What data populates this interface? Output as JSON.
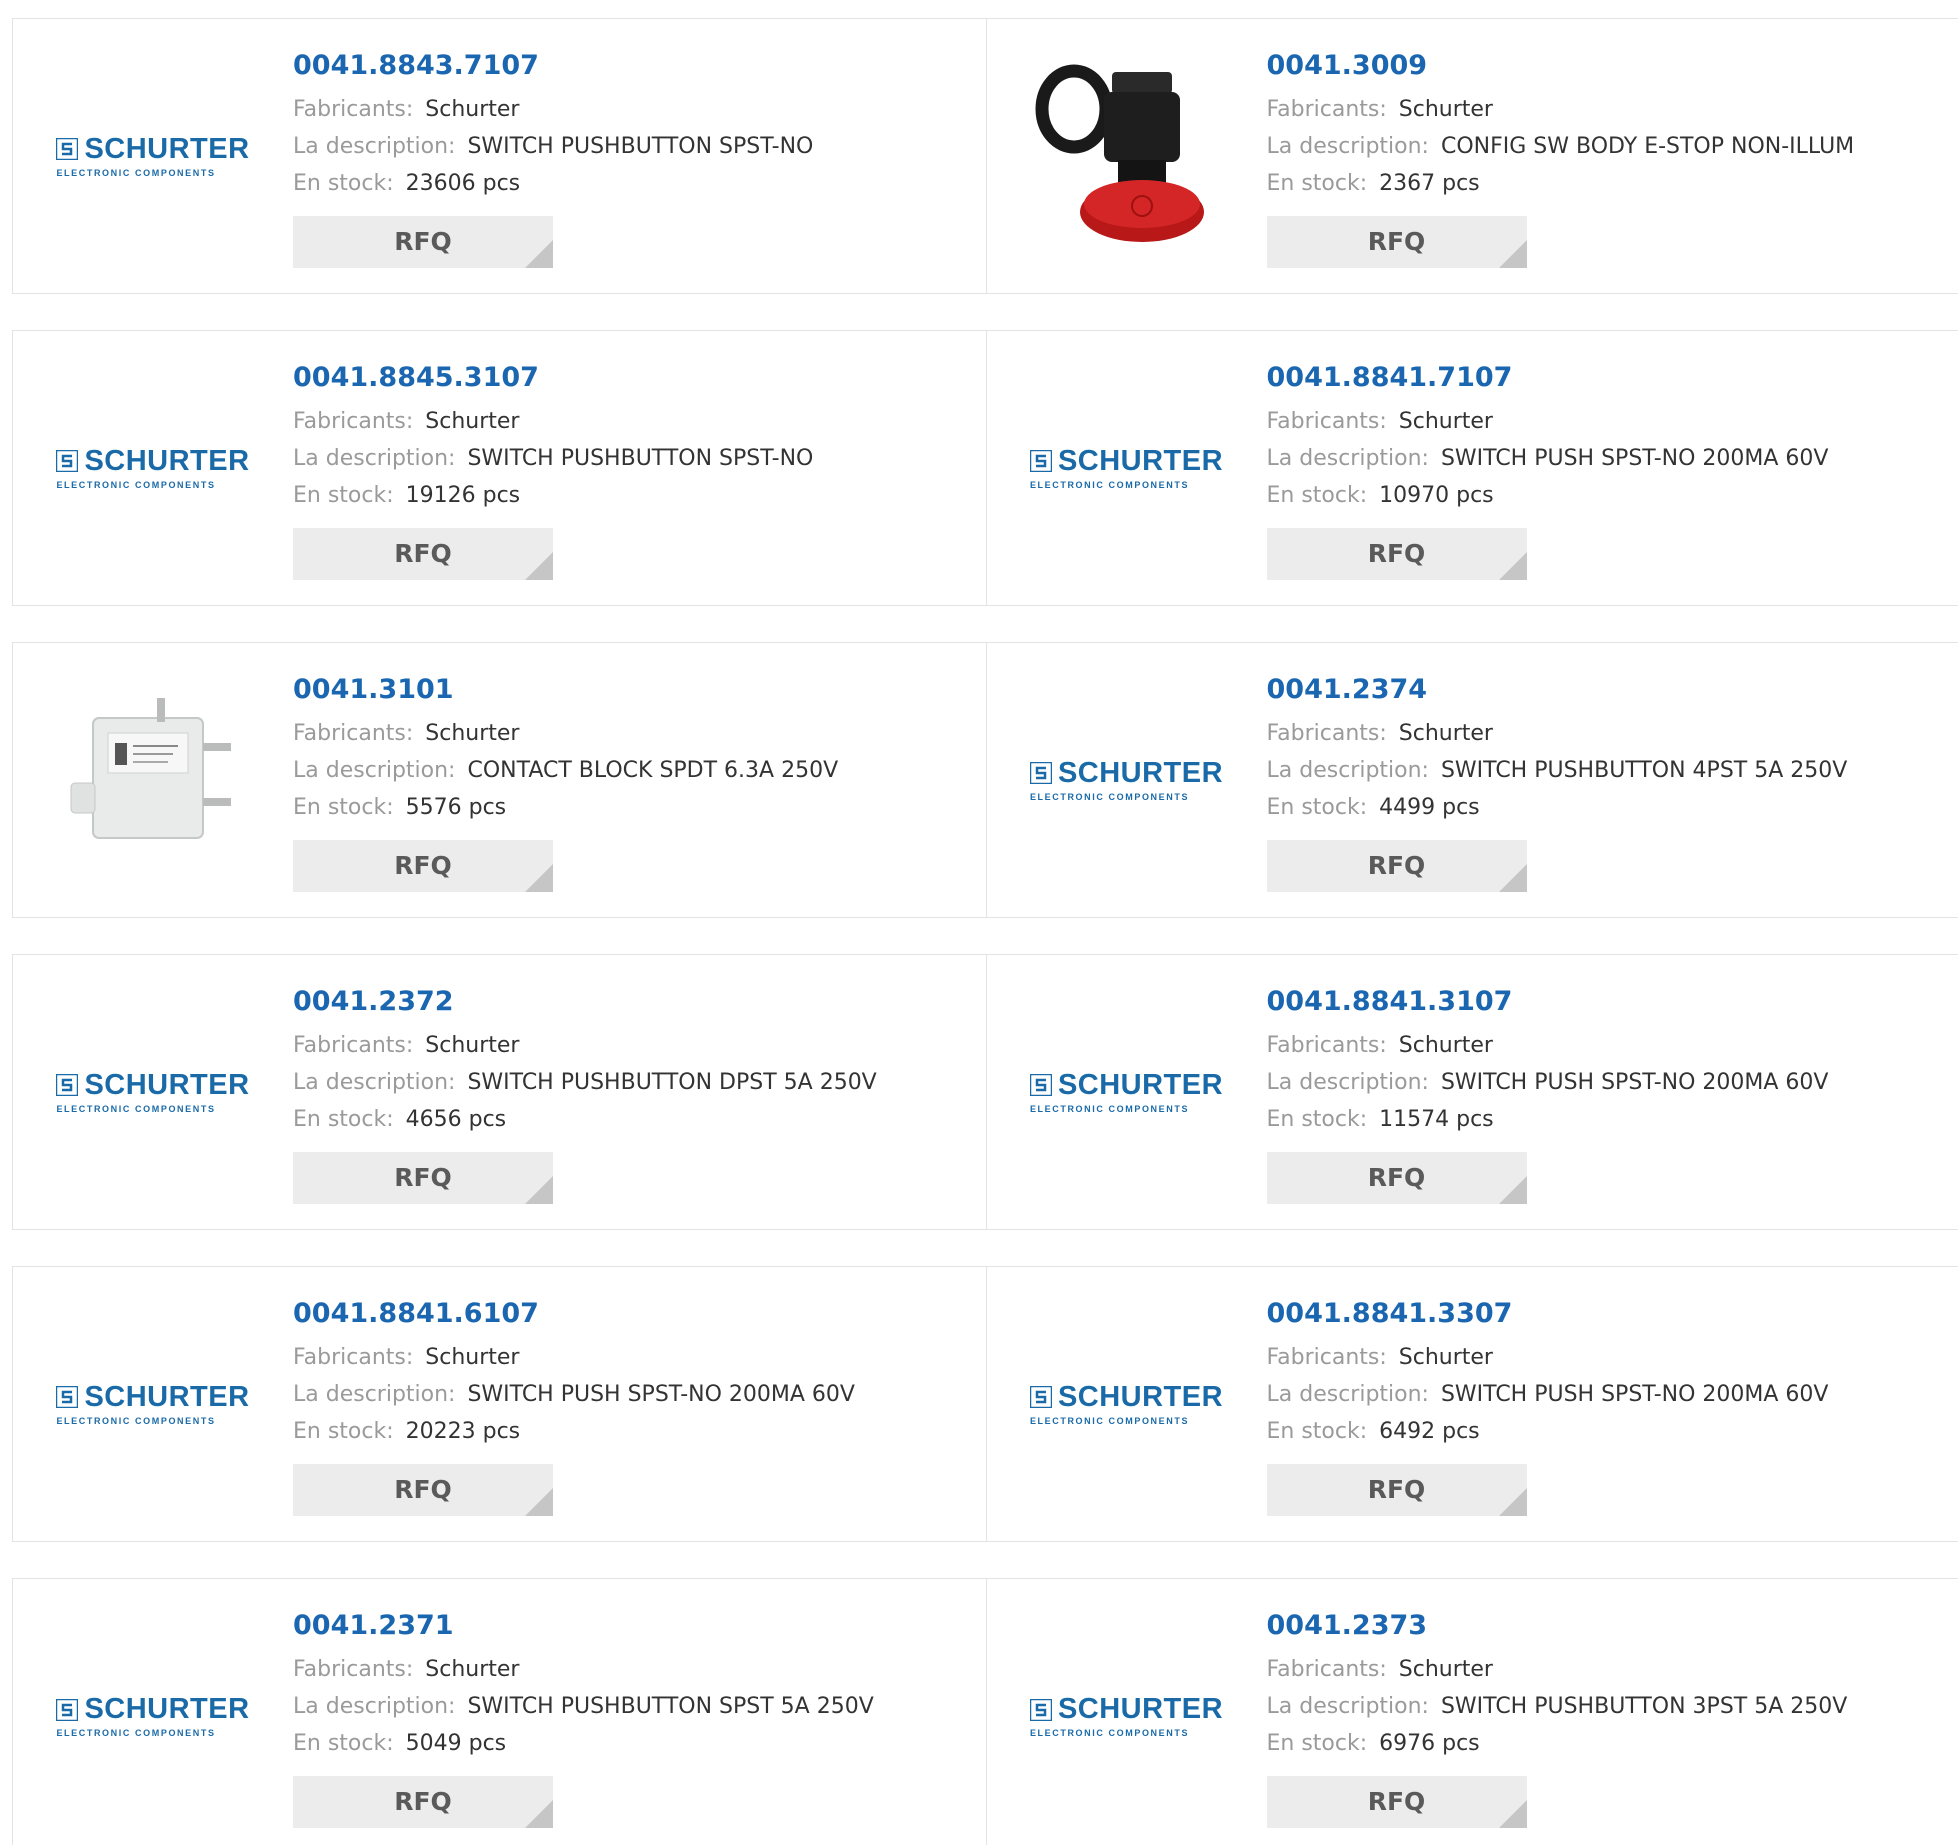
{
  "labels": {
    "manufacturer": "Fabricants:",
    "description": "La description:",
    "stock": "En stock:",
    "rfq": "RFQ"
  },
  "logo": {
    "wordmark": "SCHURTER",
    "tagline": "ELECTRONIC COMPONENTS",
    "color": "#1a6aa8"
  },
  "colors": {
    "part_link": "#1a66b0",
    "label": "#9a9a9a",
    "value": "#333333",
    "rfq_bg": "#ececec"
  },
  "products": [
    {
      "part": "0041.8843.7107",
      "manufacturer": "Schurter",
      "description": "SWITCH PUSHBUTTON SPST-NO",
      "stock": "23606 pcs",
      "image": "schurter-logo"
    },
    {
      "part": "0041.3009",
      "manufacturer": "Schurter",
      "description": "CONFIG SW BODY E-STOP NON-ILLUM",
      "stock": "2367 pcs",
      "image": "estop-switch-photo"
    },
    {
      "part": "0041.8845.3107",
      "manufacturer": "Schurter",
      "description": "SWITCH PUSHBUTTON SPST-NO",
      "stock": "19126 pcs",
      "image": "schurter-logo"
    },
    {
      "part": "0041.8841.7107",
      "manufacturer": "Schurter",
      "description": "SWITCH PUSH SPST-NO 200MA 60V",
      "stock": "10970 pcs",
      "image": "schurter-logo"
    },
    {
      "part": "0041.3101",
      "manufacturer": "Schurter",
      "description": "CONTACT BLOCK SPDT 6.3A 250V",
      "stock": "5576 pcs",
      "image": "contact-block-photo"
    },
    {
      "part": "0041.2374",
      "manufacturer": "Schurter",
      "description": "SWITCH PUSHBUTTON 4PST 5A 250V",
      "stock": "4499 pcs",
      "image": "schurter-logo"
    },
    {
      "part": "0041.2372",
      "manufacturer": "Schurter",
      "description": "SWITCH PUSHBUTTON DPST 5A 250V",
      "stock": "4656 pcs",
      "image": "schurter-logo"
    },
    {
      "part": "0041.8841.3107",
      "manufacturer": "Schurter",
      "description": "SWITCH PUSH SPST-NO 200MA 60V",
      "stock": "11574 pcs",
      "image": "schurter-logo"
    },
    {
      "part": "0041.8841.6107",
      "manufacturer": "Schurter",
      "description": "SWITCH PUSH SPST-NO 200MA 60V",
      "stock": "20223 pcs",
      "image": "schurter-logo"
    },
    {
      "part": "0041.8841.3307",
      "manufacturer": "Schurter",
      "description": "SWITCH PUSH SPST-NO 200MA 60V",
      "stock": "6492 pcs",
      "image": "schurter-logo"
    },
    {
      "part": "0041.2371",
      "manufacturer": "Schurter",
      "description": "SWITCH PUSHBUTTON SPST 5A 250V",
      "stock": "5049 pcs",
      "image": "schurter-logo"
    },
    {
      "part": "0041.2373",
      "manufacturer": "Schurter",
      "description": "SWITCH PUSHBUTTON 3PST 5A 250V",
      "stock": "6976 pcs",
      "image": "schurter-logo"
    }
  ]
}
